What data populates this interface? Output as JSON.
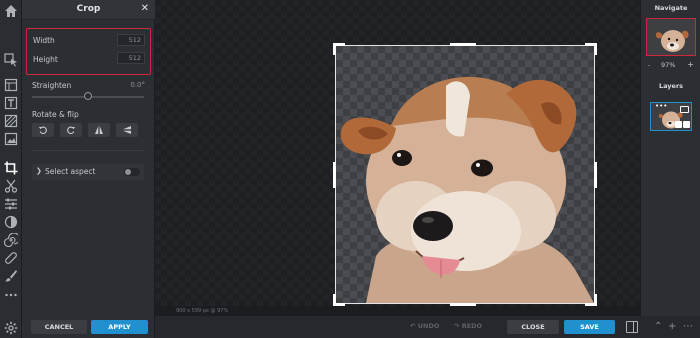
{
  "toolbar": {
    "tools": [
      {
        "name": "home",
        "glyph": "⌂"
      },
      {
        "name": "select",
        "glyph": "⇱"
      },
      {
        "name": "layers",
        "glyph": "☰"
      },
      {
        "name": "text",
        "glyph": "T"
      },
      {
        "name": "pattern",
        "glyph": "▨"
      },
      {
        "name": "image",
        "glyph": "▣"
      },
      {
        "name": "crop",
        "glyph": "⌗"
      },
      {
        "name": "cut",
        "glyph": "✂"
      },
      {
        "name": "adjust",
        "glyph": "☷"
      },
      {
        "name": "brush-eraser",
        "glyph": "✒"
      },
      {
        "name": "color",
        "glyph": "◐"
      },
      {
        "name": "spiral",
        "glyph": "@"
      },
      {
        "name": "bandage",
        "glyph": "✎"
      },
      {
        "name": "drop",
        "glyph": "✐"
      },
      {
        "name": "more",
        "glyph": "⋯"
      },
      {
        "name": "settings",
        "glyph": "⚙"
      }
    ]
  },
  "crop_panel": {
    "title": "Crop",
    "close_glyph": "✕",
    "width_label": "Width",
    "width_value": "512",
    "height_label": "Height",
    "height_value": "512",
    "straighten_label": "Straighten",
    "straighten_value": "0.0°",
    "straighten_level": 0.5,
    "rotate_flip_label": "Rotate & flip",
    "rotate_buttons": [
      {
        "name": "rotate-left",
        "glyph": "↺"
      },
      {
        "name": "rotate-right",
        "glyph": "↻"
      },
      {
        "name": "flip-horizontal",
        "glyph": "◭"
      },
      {
        "name": "flip-vertical",
        "glyph": "◂"
      }
    ],
    "select_aspect_label": "Select aspect",
    "select_aspect_on": false,
    "cancel_label": "CANCEL",
    "apply_label": "APPLY"
  },
  "canvas": {
    "info_text": "900 x 599 px @ 97%"
  },
  "bottom_bar": {
    "undo_label": "UNDO",
    "redo_label": "REDO",
    "close_label": "CLOSE",
    "save_label": "SAVE"
  },
  "right_panel": {
    "navigate_title": "Navigate",
    "zoom_minus": "-",
    "zoom_value": "97%",
    "zoom_plus": "+",
    "layers_title": "Layers",
    "layer_menu": "•••"
  },
  "colors": {
    "accent": "#2190cf",
    "highlight": "#d0283a",
    "panel_bg": "#2b2e32"
  }
}
